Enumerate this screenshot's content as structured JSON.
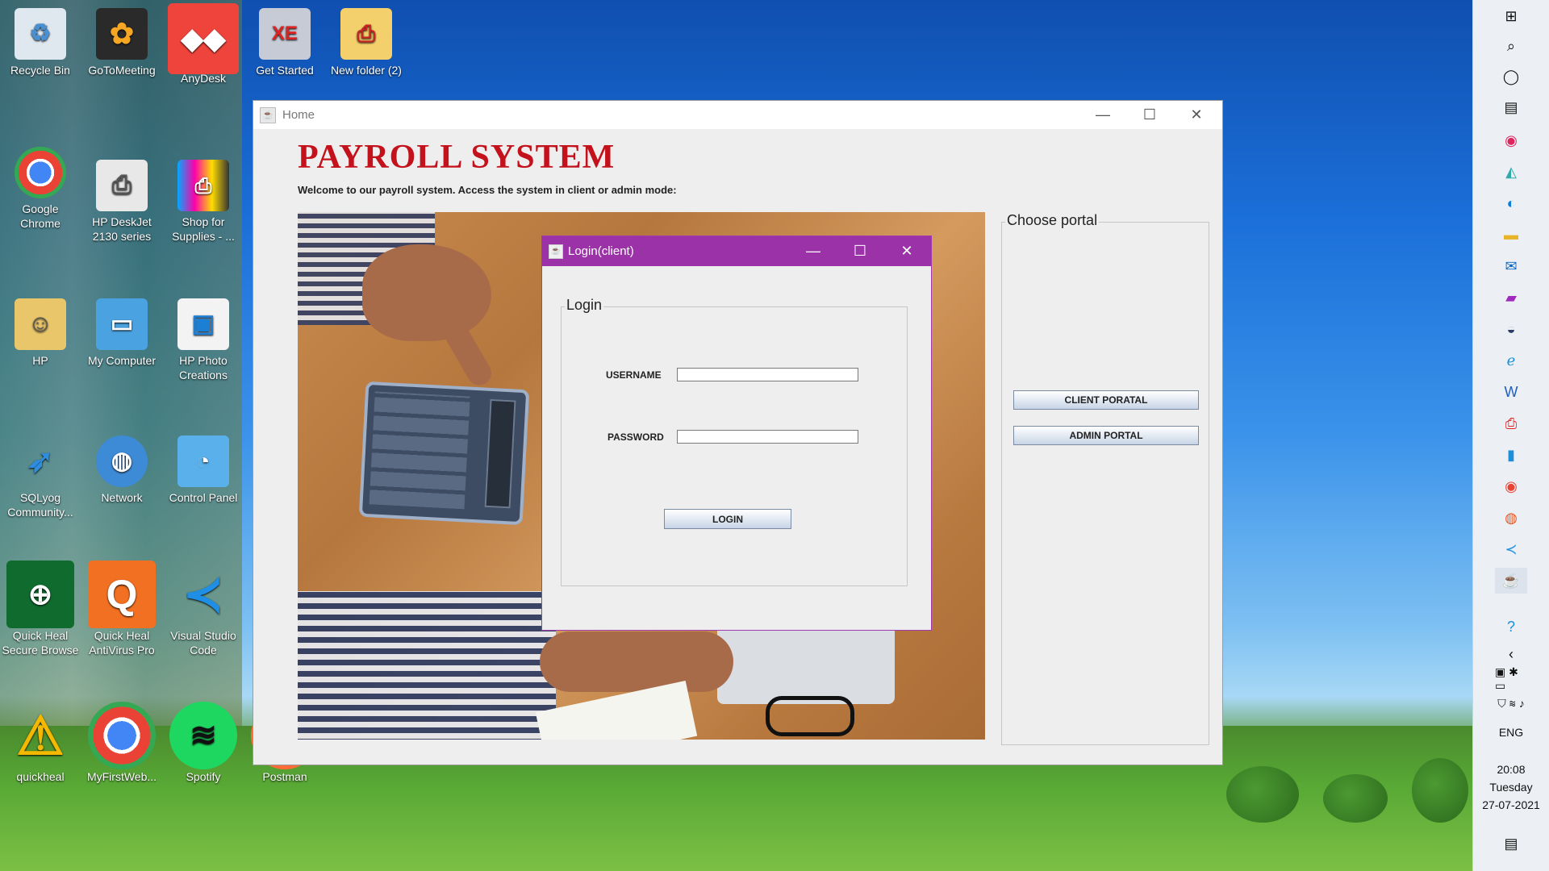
{
  "desktop": {
    "icons": [
      {
        "label": "Recycle Bin",
        "icon": "recycle-bin-icon"
      },
      {
        "label": "GoToMeeting",
        "icon": "gotomeeting-icon"
      },
      {
        "label": "AnyDesk",
        "icon": "anydesk-icon"
      },
      {
        "label": "Get Started",
        "icon": "database-xe-icon"
      },
      {
        "label": "New folder (2)",
        "icon": "folder-pdf-icon"
      },
      {
        "label": "Google Chrome",
        "icon": "chrome-icon"
      },
      {
        "label": "HP DeskJet 2130 series",
        "icon": "printer-icon"
      },
      {
        "label": "Shop for Supplies - ...",
        "icon": "printer-supplies-icon"
      },
      {
        "label": "HP",
        "icon": "user-folder-icon"
      },
      {
        "label": "My Computer",
        "icon": "computer-icon"
      },
      {
        "label": "HP Photo Creations",
        "icon": "photo-icon"
      },
      {
        "label": "SQLyog Community...",
        "icon": "dolphin-icon"
      },
      {
        "label": "Network",
        "icon": "network-icon"
      },
      {
        "label": "Control Panel",
        "icon": "control-panel-icon"
      },
      {
        "label": "Quick Heal Secure Browse",
        "icon": "globe-shield-icon"
      },
      {
        "label": "Quick Heal AntiVirus Pro",
        "icon": "quickheal-icon"
      },
      {
        "label": "Visual Studio Code",
        "icon": "vscode-icon"
      },
      {
        "label": "quickheal",
        "icon": "warning-icon"
      },
      {
        "label": "MyFirstWeb...",
        "icon": "chrome-icon"
      },
      {
        "label": "Spotify",
        "icon": "spotify-icon"
      },
      {
        "label": "Postman",
        "icon": "postman-icon"
      }
    ]
  },
  "home_window": {
    "title": "Home",
    "app_title": "PAYROLL SYSTEM",
    "subtitle": "Welcome to our payroll system. Access the system in client or admin mode:",
    "portal_group": "Choose portal",
    "client_button": "CLIENT PORATAL",
    "admin_button": "ADMIN PORTAL"
  },
  "login_window": {
    "title": "Login(client)",
    "group": "Login",
    "username_label": "USERNAME",
    "password_label": "PASSWORD",
    "username_value": "",
    "password_value": "",
    "login_button": "LOGIN"
  },
  "taskbar": {
    "language": "ENG",
    "time": "20:08",
    "day": "Tuesday",
    "date": "27-07-2021"
  },
  "colors": {
    "title_red": "#c4121c",
    "login_titlebar": "#9b32a8"
  }
}
